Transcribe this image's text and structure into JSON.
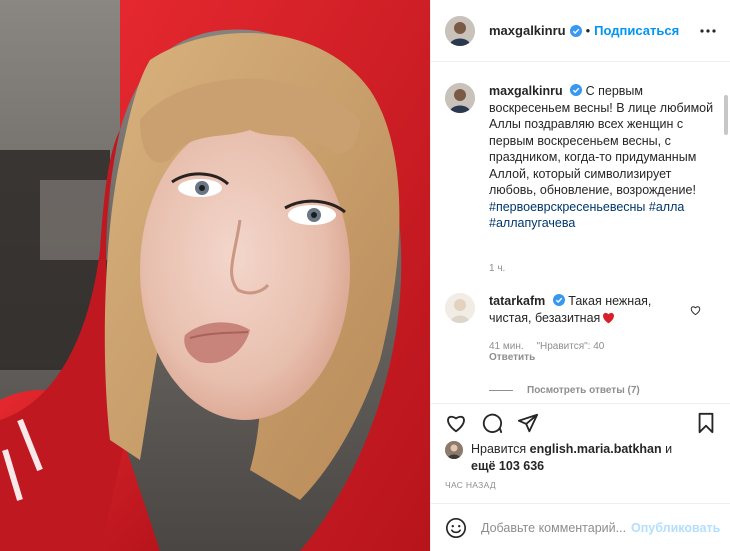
{
  "post": {
    "author": "maxgalkinru",
    "follow_label": "Подписаться",
    "dot": "•",
    "caption": {
      "username": "maxgalkinru",
      "text": "С первым воскресеньем весны! В лице любимой Аллы поздравляю всех женщин с первым воскресеньем весны, с праздником, когда-то придуманным Аллой, который символизирует любовь, обновление, возрождение!",
      "hashtags": [
        "#первоеврскресеньевесны",
        "#алла",
        "#аллапугачева"
      ],
      "time": "1 ч."
    },
    "comment": {
      "username": "tatarkafm",
      "text": "Такая нежная, чистая, безазитная",
      "time": "41 мин.",
      "likes": "\"Нравится\": 40",
      "reply_label": "Ответить",
      "view_replies": "Посмотреть ответы (7)"
    },
    "likes": {
      "prefix": "Нравится",
      "user": "english.maria.batkhan",
      "middle": "и",
      "rest": "ещё 103 636"
    },
    "date": "час назад",
    "comment_box": {
      "placeholder": "Добавьте комментарий...",
      "publish_label": "Опубликовать"
    }
  },
  "icons": {
    "more": "more-icon",
    "like": "heart-icon",
    "comment": "comment-icon",
    "share": "send-icon",
    "save": "bookmark-icon",
    "emoji": "emoji-icon",
    "verified": "verified-badge-icon"
  },
  "colors": {
    "link": "#0095f6",
    "hashtag": "#00376b",
    "muted": "#8e8e8e",
    "heart_red": "#ed4956",
    "hood_red": "#d8202a"
  }
}
